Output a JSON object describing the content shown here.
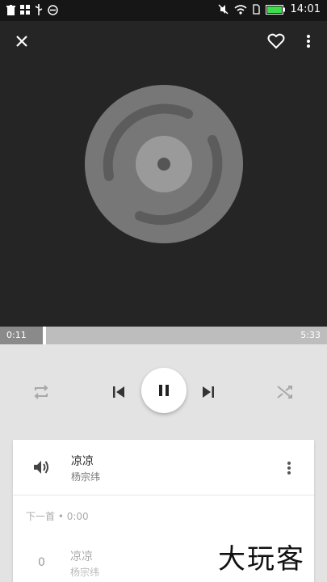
{
  "status_bar": {
    "time": "14:01",
    "icons": [
      "trash-icon",
      "grid-icon",
      "usb-icon",
      "dnd-icon",
      "mute-icon",
      "wifi-icon",
      "sim-icon",
      "battery-icon"
    ]
  },
  "header": {
    "close_icon": "close-icon",
    "favorite_icon": "heart-icon",
    "menu_icon": "more-vert-icon"
  },
  "player": {
    "elapsed": "0:11",
    "duration": "5:33",
    "progress_fraction": 0.034
  },
  "controls": {
    "repeat_icon": "repeat-icon",
    "prev_icon": "skip-previous-icon",
    "pause_icon": "pause-icon",
    "next_icon": "skip-next-icon",
    "shuffle_icon": "shuffle-icon"
  },
  "queue": {
    "current": {
      "title": "凉凉",
      "artist": "杨宗纬",
      "icon": "speaker-icon"
    },
    "next_label": "下一首 • 0:00",
    "upcoming": [
      {
        "index": "0",
        "title": "凉凉",
        "artist": "杨宗纬"
      }
    ]
  },
  "watermark": "大玩客",
  "colors": {
    "art_bg": "#252525",
    "panel_bg": "#e3e3e3",
    "progress_track": "#bdbdbd"
  }
}
